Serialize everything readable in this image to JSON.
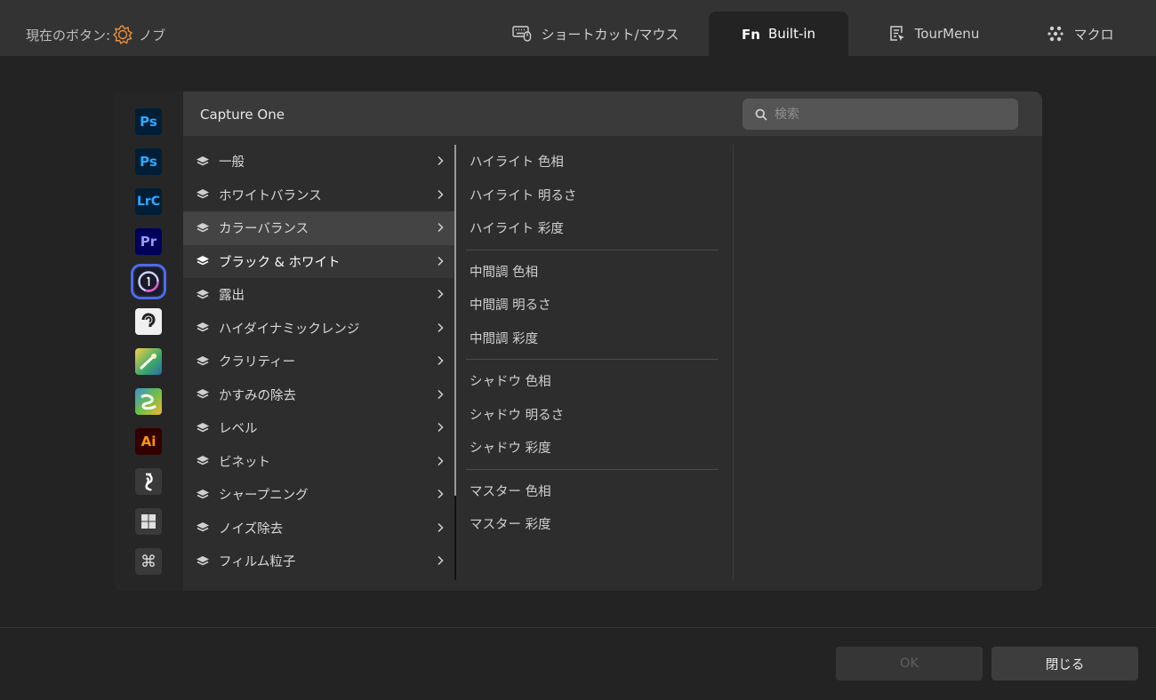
{
  "header": {
    "current_button_label": "現在のボタン:",
    "current_button_value": "ノブ",
    "tabs": [
      {
        "label": "ショートカット/マウス",
        "icon": "keyboard-mouse-icon"
      },
      {
        "label": "Built-in",
        "icon": "fn-icon"
      },
      {
        "label": "TourMenu",
        "icon": "tour-menu-icon"
      },
      {
        "label": "マクロ",
        "icon": "macro-icon"
      }
    ],
    "active_tab": "Built-in"
  },
  "apps": [
    {
      "label": "Ps"
    },
    {
      "label": "Ps"
    },
    {
      "label": "LrC"
    },
    {
      "label": "Pr"
    },
    {
      "label": "Capture One",
      "selected": true
    },
    {
      "label": "Clip Studio"
    },
    {
      "label": "Krita"
    },
    {
      "label": "Corel Painter"
    },
    {
      "label": "Ai"
    },
    {
      "label": "Inkscape"
    },
    {
      "label": "Windows"
    },
    {
      "label": "⌘"
    }
  ],
  "panel": {
    "title": "Capture One",
    "search_placeholder": "検索",
    "categories": [
      {
        "label": "一般"
      },
      {
        "label": "ホワイトバランス"
      },
      {
        "label": "カラーバランス",
        "state": "hover"
      },
      {
        "label": "ブラック & ホワイト",
        "state": "active"
      },
      {
        "label": "露出"
      },
      {
        "label": "ハイダイナミックレンジ"
      },
      {
        "label": "クラリティー"
      },
      {
        "label": "かすみの除去"
      },
      {
        "label": "レベル"
      },
      {
        "label": "ビネット"
      },
      {
        "label": "シャープニング"
      },
      {
        "label": "ノイズ除去"
      },
      {
        "label": "フィルム粒子"
      }
    ],
    "functions": [
      [
        "ハイライト 色相",
        "ハイライト 明るさ",
        "ハイライト 彩度"
      ],
      [
        "中間調 色相",
        "中間調 明るさ",
        "中間調 彩度"
      ],
      [
        "シャドウ 色相",
        "シャドウ 明るさ",
        "シャドウ 彩度"
      ],
      [
        "マスター 色相",
        "マスター 彩度"
      ]
    ]
  },
  "footer": {
    "ok_label": "OK",
    "close_label": "閉じる"
  },
  "colors": {
    "accent": "#4a6cf0",
    "knob_icon": "#e8923a",
    "background": "#232323",
    "topbar": "#333333"
  }
}
